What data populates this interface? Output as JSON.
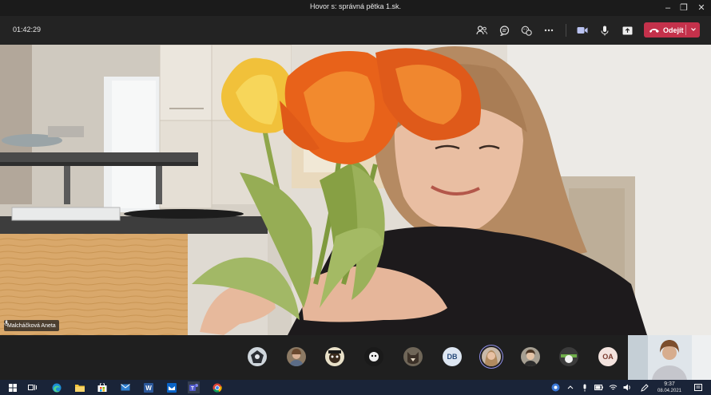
{
  "window": {
    "title": "Hovor s: správná pětka 1.sk."
  },
  "toolbar": {
    "timer": "01:42:29",
    "buttons": [
      {
        "name": "participants-icon"
      },
      {
        "name": "chat-icon"
      },
      {
        "name": "reactions-icon"
      },
      {
        "name": "more-icon"
      },
      {
        "name": "camera-icon"
      },
      {
        "name": "microphone-icon"
      },
      {
        "name": "share-screen-icon"
      }
    ],
    "leave_label": "Odejít",
    "leave_color": "#c4314b"
  },
  "stage": {
    "speaker_name": "Malcháčková Aneta"
  },
  "participants": [
    {
      "type": "photo",
      "name": "avatar-photo-1"
    },
    {
      "type": "photo",
      "name": "avatar-photo-2"
    },
    {
      "type": "photo",
      "name": "avatar-photo-3"
    },
    {
      "type": "photo",
      "name": "avatar-photo-4"
    },
    {
      "type": "photo",
      "name": "avatar-photo-5"
    },
    {
      "type": "initials",
      "initials": "DB"
    },
    {
      "type": "photo",
      "name": "avatar-photo-6",
      "selected": true
    },
    {
      "type": "photo",
      "name": "avatar-photo-7"
    },
    {
      "type": "photo",
      "name": "avatar-photo-8"
    },
    {
      "type": "initials",
      "initials": "OA"
    }
  ],
  "taskbar": {
    "apps": [
      "start-icon",
      "task-view-icon",
      "edge-icon",
      "file-explorer-icon",
      "store-icon",
      "mail-icon",
      "word-icon",
      "outlook-icon",
      "teams-icon",
      "chrome-icon"
    ],
    "time": "9:37",
    "date": "08.04.2021"
  }
}
